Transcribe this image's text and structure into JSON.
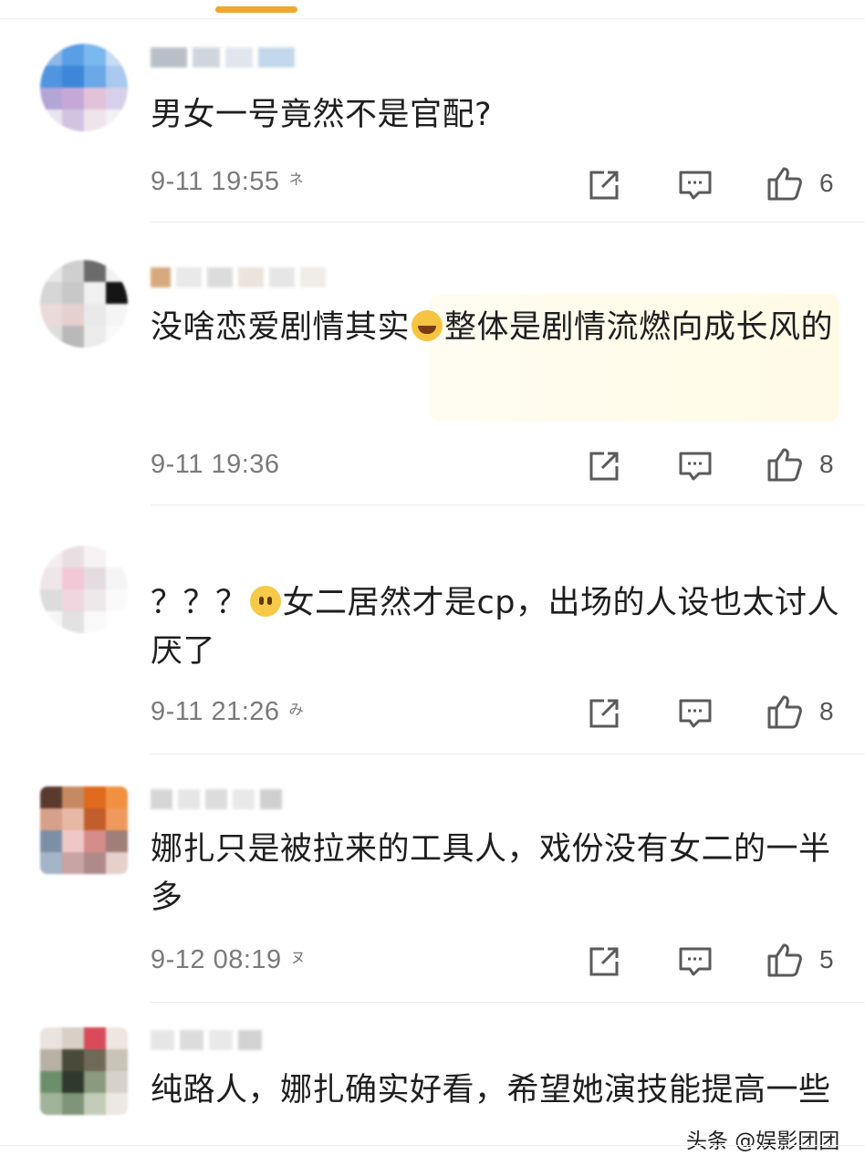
{
  "colors": {
    "indicator": "#f0a830",
    "meta_text": "#7a7a7a",
    "icon": "#5a5a5a"
  },
  "comments": [
    {
      "content": "男女一号竟然不是官配?",
      "time": "9-11 19:55",
      "suffix": "",
      "likes": "6",
      "icons": [
        "share-icon",
        "comment-icon",
        "thumbs-up-icon"
      ]
    },
    {
      "content_before": "没啥恋爱剧情其实",
      "emoji": "laughing-tears-emoji",
      "content_after": "整体是剧情流燃向成长风的",
      "time": "9-11 19:36",
      "likes": "8"
    },
    {
      "content_before": "？？？",
      "emoji": "upside-down-face-emoji",
      "content_after": "女二居然才是cp，出场的人设也太讨人厌了",
      "time": "9-11 21:26",
      "likes": "8"
    },
    {
      "content": "娜扎只是被拉来的工具人，戏份没有女二的一半多",
      "time": "9-12 08:19",
      "likes": "5"
    },
    {
      "content": "纯路人，娜扎确实好看，希望她演技能提高一些"
    }
  ],
  "watermark": "头条 @娱影团团"
}
